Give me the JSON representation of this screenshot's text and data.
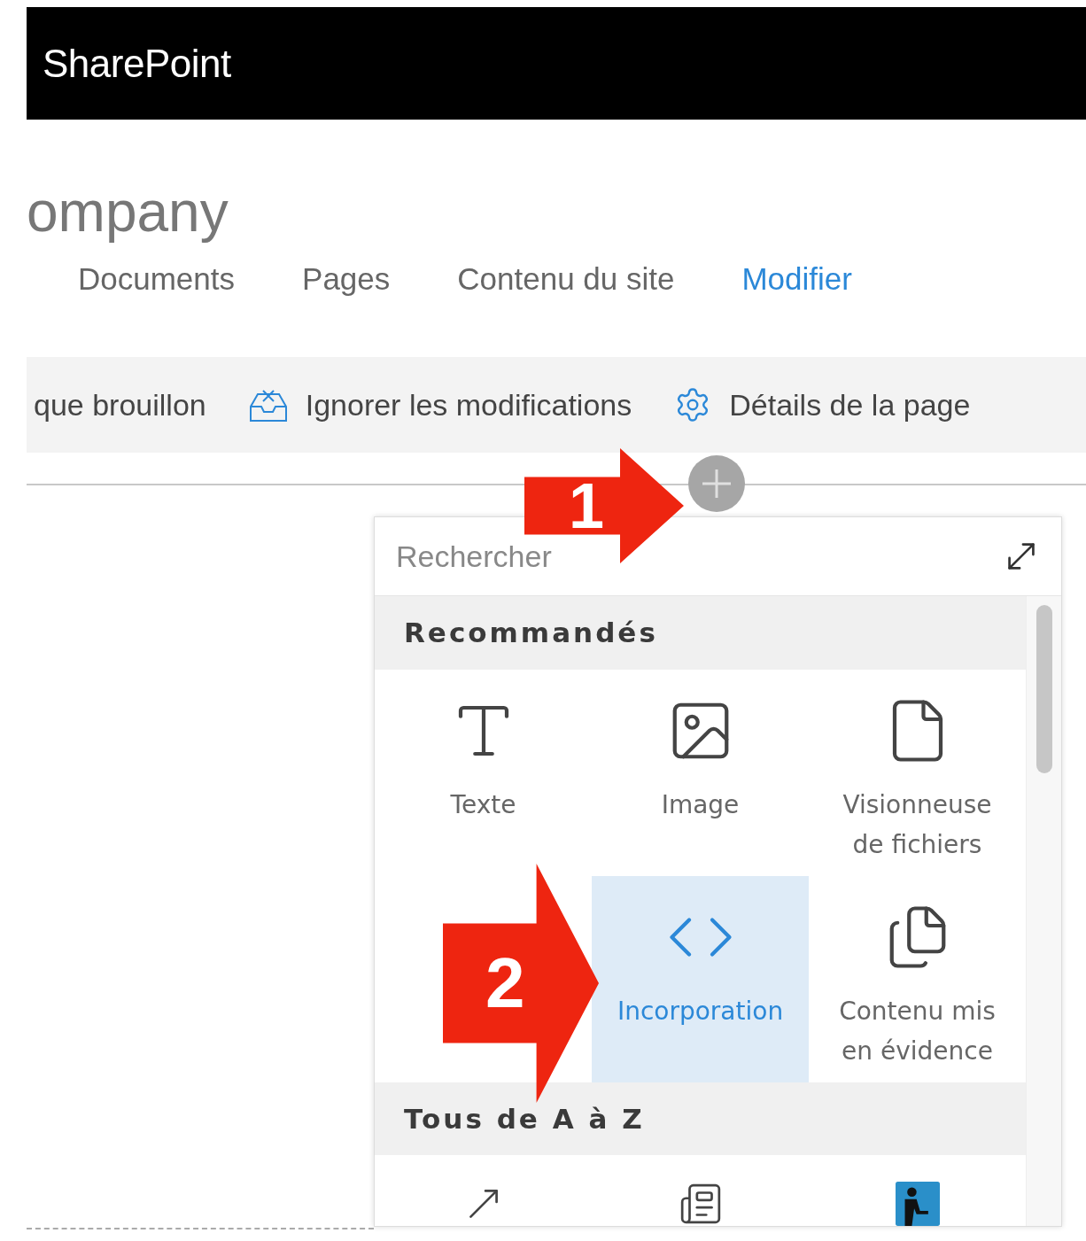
{
  "header": {
    "title": "SharePoint"
  },
  "site": {
    "title": "ompany"
  },
  "nav": [
    {
      "label": "Documents",
      "selected": false
    },
    {
      "label": "Pages",
      "selected": false
    },
    {
      "label": "Contenu du site",
      "selected": false
    },
    {
      "label": "Modifier",
      "selected": true
    }
  ],
  "toolbar": [
    {
      "label": "que brouillon",
      "kind": "plain"
    },
    {
      "label": "Ignorer les modifications",
      "kind": "discard"
    },
    {
      "label": "Détails de la page",
      "kind": "settings"
    }
  ],
  "picker": {
    "search": {
      "placeholder": "Rechercher"
    },
    "sections": [
      {
        "title": "Recommandés",
        "items": [
          {
            "label": "Texte",
            "kind": "text",
            "selected": false
          },
          {
            "label": "Image",
            "kind": "image",
            "selected": false
          },
          {
            "label": "Visionneuse de fichiers",
            "kind": "file",
            "selected": false
          },
          {
            "kind": "empty"
          },
          {
            "label": "Incorporation",
            "kind": "embed",
            "selected": true
          },
          {
            "label": "Contenu mis en évidence",
            "kind": "highlight",
            "selected": false
          }
        ]
      },
      {
        "title": "Tous de A à Z",
        "items": [
          {
            "kind": "link",
            "selected": false
          },
          {
            "kind": "news",
            "selected": false
          },
          {
            "kind": "person",
            "selected": false
          }
        ]
      }
    ]
  },
  "callouts": [
    {
      "label": "1"
    },
    {
      "label": "2"
    }
  ]
}
